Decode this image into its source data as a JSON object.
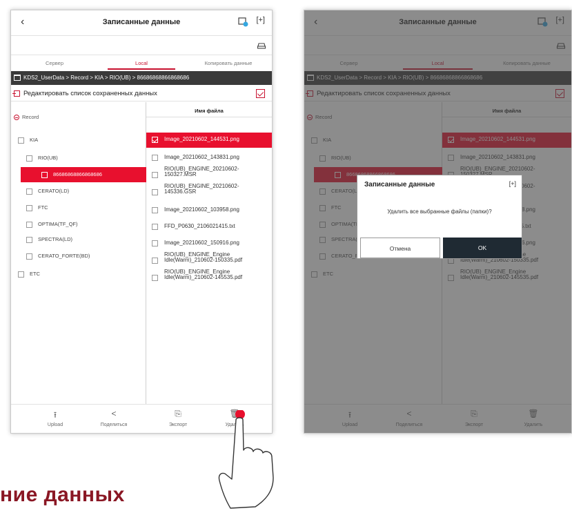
{
  "screen": {
    "title": "Записанные данные",
    "tabs": [
      "Сервер",
      "Local",
      "Копировать данные"
    ],
    "active_tab": 1,
    "breadcrumb": "KDS2_UserData > Record > KIA > RIO(UB) > 86686868866868686",
    "edit_label": "Редактировать список сохраненных данных",
    "tree": {
      "root": "Record",
      "nodes": [
        {
          "label": "KIA",
          "level": 1,
          "selected": false
        },
        {
          "label": "RIO(UB)",
          "level": 2,
          "selected": false
        },
        {
          "label": "86686868866868686",
          "level": 3,
          "selected": true
        },
        {
          "label": "CERATO(LD)",
          "level": 2,
          "selected": false
        },
        {
          "label": "FTC",
          "level": 2,
          "selected": false
        },
        {
          "label": "OPTIMA(TF_QF)",
          "level": 2,
          "selected": false
        },
        {
          "label": "SPECTRA(LD)",
          "level": 2,
          "selected": false
        },
        {
          "label": "CERATO_FORTE(BD)",
          "level": 2,
          "selected": false
        },
        {
          "label": "ETC",
          "level": 1,
          "selected": false
        }
      ]
    },
    "files_header": "Имя файла",
    "files": [
      {
        "name": "Image_20210602_144531.png",
        "checked": true
      },
      {
        "name": "Image_20210602_143831.png",
        "checked": false
      },
      {
        "name": "RIO(UB)_ENGINE_20210602-150327.MSR",
        "checked": false
      },
      {
        "name": "RIO(UB)_ENGINE_20210602-145336.GSR",
        "checked": false
      },
      {
        "name": "Image_20210602_103958.png",
        "checked": false
      },
      {
        "name": "FFD_P0630_2106021415.txt",
        "checked": false
      },
      {
        "name": "Image_20210602_150916.png",
        "checked": false
      },
      {
        "name": "RIO(UB)_ENGINE_Engine Idle(Warm)_210602-150335.pdf",
        "checked": false
      },
      {
        "name": "RIO(UB)_ENGINE_Engine Idle(Warm)_210602-145535.pdf",
        "checked": false
      }
    ],
    "bottom_bar": [
      {
        "label": "Upload",
        "icon": "upload-icon"
      },
      {
        "label": "Поделиться",
        "icon": "share-icon"
      },
      {
        "label": "Экспорт",
        "icon": "export-icon"
      },
      {
        "label": "Удалить",
        "icon": "delete-icon"
      }
    ]
  },
  "dialog": {
    "title": "Записанные данные",
    "message": "Удалить все выбранные файлы (папки)?",
    "cancel": "Отмена",
    "ok": "OK"
  },
  "caption": "ние данных",
  "colors": {
    "accent": "#e8102e",
    "dark": "#3a3a3a",
    "ok_button": "#1f2a33",
    "caption": "#8a1724"
  }
}
